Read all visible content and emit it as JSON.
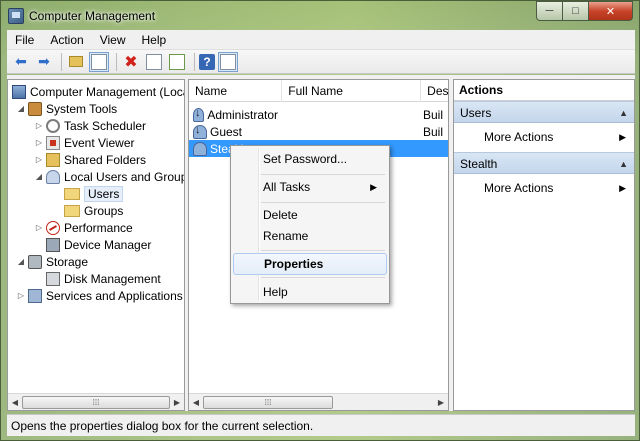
{
  "window": {
    "title": "Computer Management",
    "controls": {
      "minimize": "─",
      "maximize": "□",
      "close": "✕"
    }
  },
  "menu": [
    "File",
    "Action",
    "View",
    "Help"
  ],
  "toolbar": {
    "icons": [
      "back-arrow-icon",
      "forward-arrow-icon",
      "up-folder-icon",
      "show-hide-tree-icon",
      "delete-icon",
      "properties-icon",
      "export-list-icon",
      "help-icon",
      "show-hide-action-pane-icon"
    ]
  },
  "tree": {
    "items": [
      {
        "label": "Computer Management (Local",
        "level": 0,
        "expander": ""
      },
      {
        "label": "System Tools",
        "level": 1,
        "expander": "◢"
      },
      {
        "label": "Task Scheduler",
        "level": 2,
        "expander": "▷"
      },
      {
        "label": "Event Viewer",
        "level": 2,
        "expander": "▷"
      },
      {
        "label": "Shared Folders",
        "level": 2,
        "expander": "▷"
      },
      {
        "label": "Local Users and Groups",
        "level": 2,
        "expander": "◢"
      },
      {
        "label": "Users",
        "level": 3,
        "expander": ""
      },
      {
        "label": "Groups",
        "level": 3,
        "expander": ""
      },
      {
        "label": "Performance",
        "level": 2,
        "expander": "▷"
      },
      {
        "label": "Device Manager",
        "level": 2,
        "expander": ""
      },
      {
        "label": "Storage",
        "level": 1,
        "expander": "◢"
      },
      {
        "label": "Disk Management",
        "level": 2,
        "expander": ""
      },
      {
        "label": "Services and Applications",
        "level": 1,
        "expander": "▷"
      }
    ]
  },
  "list": {
    "columns": [
      "Name",
      "Full Name",
      "Des"
    ],
    "rows": [
      {
        "name": "Administrator",
        "description": "Buil"
      },
      {
        "name": "Guest",
        "description": "Buil"
      },
      {
        "name": "Stealth",
        "description": ""
      }
    ]
  },
  "scroll": {
    "left": "◀",
    "right": "▶",
    "grip": "⁞⁞⁞"
  },
  "context_menu": {
    "items": [
      "Set Password...",
      "All Tasks",
      "Delete",
      "Rename",
      "Properties",
      "Help"
    ],
    "submenu_arrow": "▶"
  },
  "actions": {
    "title": "Actions",
    "sections": [
      {
        "header": "Users",
        "item": "More Actions"
      },
      {
        "header": "Stealth",
        "item": "More Actions"
      }
    ],
    "collapse_glyph": "▲",
    "item_arrow": "▶"
  },
  "status": "Opens the properties dialog box for the current selection."
}
